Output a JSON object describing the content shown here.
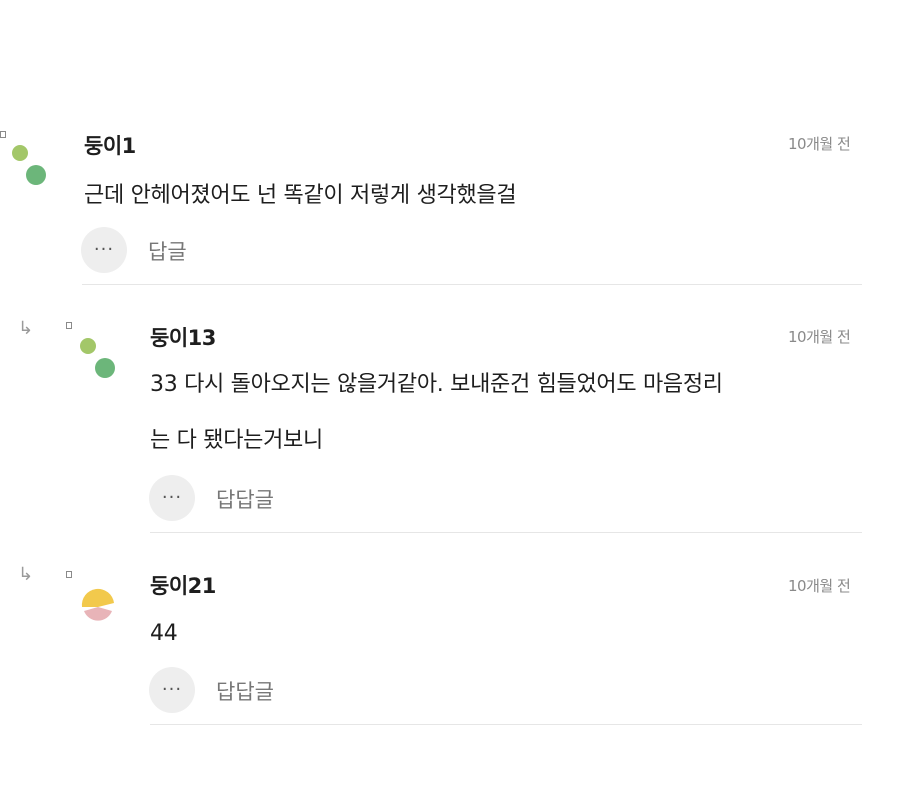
{
  "colors": {
    "avatar_light_green": "#a3c769",
    "avatar_green": "#6cb67a",
    "avatar_yellow": "#f2c94c",
    "avatar_pink": "#e8b4b8",
    "divider": "#e6e6e6"
  },
  "comments": [
    {
      "nickname": "둥이1",
      "time": "10개월 전",
      "text": "근데 안헤어졌어도 넌 똑같이 저렇게 생각했을걸",
      "more_icon": "···",
      "reply_label": "답글"
    },
    {
      "nickname": "둥이13",
      "time": "10개월 전",
      "text": "33 다시 돌아오지는 않을거같아. 보내준건 힘들었어도 마음정리\n는 다 됐다는거보니",
      "more_icon": "···",
      "reply_label": "답답글",
      "reply_arrow": "↳"
    },
    {
      "nickname": "둥이21",
      "time": "10개월 전",
      "text": "44",
      "more_icon": "···",
      "reply_label": "답답글",
      "reply_arrow": "↳"
    }
  ]
}
